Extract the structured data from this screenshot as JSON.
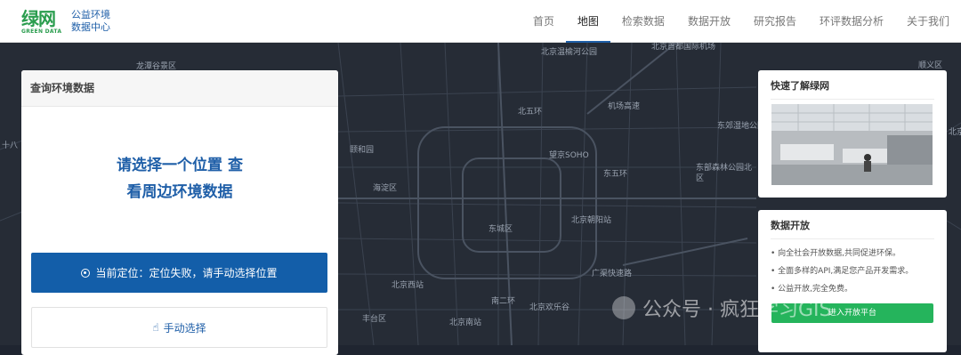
{
  "header": {
    "logo_big": "绿网",
    "logo_small": "GREEN DATA",
    "logo_line1": "公益环境",
    "logo_line2": "数据中心",
    "nav": [
      "首页",
      "地图",
      "检索数据",
      "数据开放",
      "研究报告",
      "环评数据分析",
      "关于我们"
    ],
    "active_nav": "地图"
  },
  "map": {
    "labels": [
      "北京温榆河公园",
      "北京首都国际机场",
      "北五环",
      "机场高速",
      "东郊湿地公园",
      "颐和园",
      "望京SOHO",
      "东五环",
      "东部森林公园北区",
      "海淀区",
      "北京朝阳站",
      "东城区",
      "北京西站",
      "广渠快速路",
      "南二环",
      "北京欢乐谷",
      "丰台区",
      "北京南站",
      "龙潭谷景区",
      "十八",
      "顺义区",
      "北京"
    ]
  },
  "query_panel": {
    "title": "查询环境数据",
    "prompt_line1": "请选择一个位置 查",
    "prompt_line2": "看周边环境数据",
    "locate_button": "当前定位：定位失败，请手动选择位置",
    "manual_button": "手动选择"
  },
  "about_card": {
    "title": "快速了解绿网"
  },
  "open_data_card": {
    "title": "数据开放",
    "bullets": [
      "• 向全社会开放数据,共同促进环保。",
      "• 全面多样的API,满足您产品开发需求。",
      "• 公益开放,完全免费。"
    ],
    "button": "进入开放平台"
  },
  "watermark": {
    "text": "公众号 · 疯狂学习GIS"
  },
  "colors": {
    "primary_blue": "#135ea9",
    "brand_green": "#2a9d4e",
    "button_green": "#25b45c",
    "map_bg": "#262c36"
  }
}
